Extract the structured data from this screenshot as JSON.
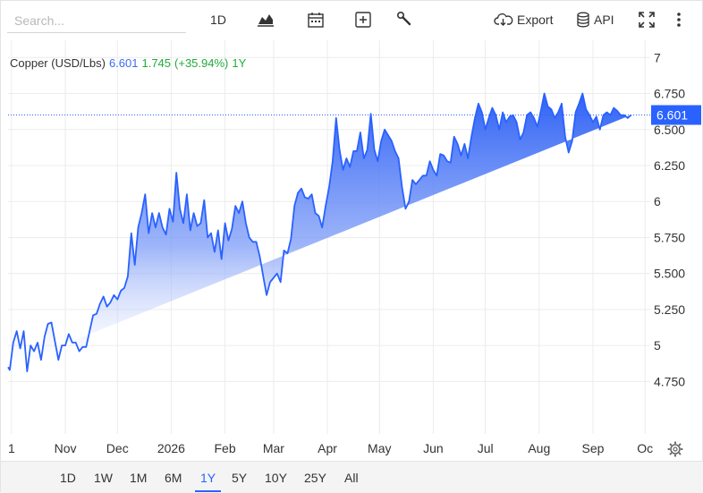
{
  "toolbar": {
    "search_placeholder": "Search...",
    "interval": "1D",
    "export_label": "Export",
    "api_label": "API"
  },
  "legend": {
    "instrument": "Copper (USD/Lbs)",
    "last": "6.601",
    "change": "1.745",
    "change_pct": "(+35.94%)",
    "period": "1Y"
  },
  "colors": {
    "line": "#2962ff",
    "positive": "#22ab3a",
    "value_blue": "#3b6cf0",
    "price_tag": "#2962ff"
  },
  "range_buttons": [
    "1D",
    "1W",
    "1M",
    "6M",
    "1Y",
    "5Y",
    "10Y",
    "25Y",
    "All"
  ],
  "active_range": "1Y",
  "chart_data": {
    "type": "area",
    "title": "Copper (USD/Lbs)",
    "last_value": 6.601,
    "last_value_label": "6.601",
    "ylim": [
      4.51,
      7.12
    ],
    "y_ticks": [
      4.75,
      5,
      5.25,
      5.5,
      5.75,
      6,
      6.25,
      6.5,
      6.75,
      7
    ],
    "y_tick_labels": [
      "4.750",
      "5",
      "5.250",
      "5.500",
      "5.750",
      "6",
      "6.250",
      "6.500",
      "6.750",
      "7"
    ],
    "xlim": [
      "2025-09-29",
      "2026-10-04"
    ],
    "x_ticks": [
      "2025-10-01",
      "2025-11-01",
      "2025-12-01",
      "2026-01-01",
      "2026-02-01",
      "2026-03-01",
      "2026-04-01",
      "2026-05-01",
      "2026-06-01",
      "2026-07-01",
      "2026-08-01",
      "2026-09-01",
      "2026-10-01"
    ],
    "x_tick_labels": [
      "1",
      "Nov",
      "Dec",
      "2026",
      "Feb",
      "Mar",
      "Apr",
      "May",
      "Jun",
      "Jul",
      "Aug",
      "Sep",
      "Oc"
    ],
    "grid": true,
    "x": [
      "2025-09-29",
      "2025-09-30",
      "2025-10-02",
      "2025-10-04",
      "2025-10-06",
      "2025-10-08",
      "2025-10-10",
      "2025-10-12",
      "2025-10-14",
      "2025-10-16",
      "2025-10-18",
      "2025-10-20",
      "2025-10-22",
      "2025-10-24",
      "2025-10-26",
      "2025-10-28",
      "2025-10-30",
      "2025-11-01",
      "2025-11-03",
      "2025-11-05",
      "2025-11-07",
      "2025-11-09",
      "2025-11-11",
      "2025-11-13",
      "2025-11-15",
      "2025-11-17",
      "2025-11-19",
      "2025-11-21",
      "2025-11-23",
      "2025-11-25",
      "2025-11-27",
      "2025-11-29",
      "2025-12-01",
      "2025-12-03",
      "2025-12-05",
      "2025-12-07",
      "2025-12-09",
      "2025-12-11",
      "2025-12-13",
      "2025-12-15",
      "2025-12-17",
      "2025-12-19",
      "2025-12-21",
      "2025-12-23",
      "2025-12-25",
      "2025-12-27",
      "2025-12-29",
      "2025-12-31",
      "2026-01-02",
      "2026-01-04",
      "2026-01-06",
      "2026-01-08",
      "2026-01-10",
      "2026-01-12",
      "2026-01-14",
      "2026-01-16",
      "2026-01-18",
      "2026-01-20",
      "2026-01-22",
      "2026-01-24",
      "2026-01-26",
      "2026-01-28",
      "2026-01-30",
      "2026-02-01",
      "2026-02-03",
      "2026-02-05",
      "2026-02-07",
      "2026-02-09",
      "2026-02-11",
      "2026-02-13",
      "2026-02-15",
      "2026-02-17",
      "2026-02-19",
      "2026-02-21",
      "2026-02-23",
      "2026-02-25",
      "2026-02-27",
      "2026-03-01",
      "2026-03-03",
      "2026-03-05",
      "2026-03-07",
      "2026-03-09",
      "2026-03-11",
      "2026-03-13",
      "2026-03-15",
      "2026-03-17",
      "2026-03-19",
      "2026-03-21",
      "2026-03-23",
      "2026-03-25",
      "2026-03-27",
      "2026-03-29",
      "2026-03-31",
      "2026-04-02",
      "2026-04-04",
      "2026-04-06",
      "2026-04-08",
      "2026-04-10",
      "2026-04-12",
      "2026-04-14",
      "2026-04-16",
      "2026-04-18",
      "2026-04-20",
      "2026-04-22",
      "2026-04-24",
      "2026-04-26",
      "2026-04-28",
      "2026-04-30",
      "2026-05-02",
      "2026-05-04",
      "2026-05-06",
      "2026-05-08",
      "2026-05-10",
      "2026-05-12",
      "2026-05-14",
      "2026-05-16",
      "2026-05-18",
      "2026-05-20",
      "2026-05-22",
      "2026-05-24",
      "2026-05-26",
      "2026-05-28",
      "2026-05-30",
      "2026-06-01",
      "2026-06-03",
      "2026-06-05",
      "2026-06-07",
      "2026-06-09",
      "2026-06-11",
      "2026-06-13",
      "2026-06-15",
      "2026-06-17",
      "2026-06-19",
      "2026-06-21",
      "2026-06-23",
      "2026-06-25",
      "2026-06-27",
      "2026-06-29",
      "2026-07-01",
      "2026-07-03",
      "2026-07-05",
      "2026-07-07",
      "2026-07-09",
      "2026-07-11",
      "2026-07-13",
      "2026-07-15",
      "2026-07-17",
      "2026-07-19",
      "2026-07-21",
      "2026-07-23",
      "2026-07-25",
      "2026-07-27",
      "2026-07-29",
      "2026-07-31",
      "2026-08-02",
      "2026-08-04",
      "2026-08-06",
      "2026-08-08",
      "2026-08-10",
      "2026-08-12",
      "2026-08-14",
      "2026-08-16",
      "2026-08-18",
      "2026-08-20",
      "2026-08-22",
      "2026-08-24",
      "2026-08-26",
      "2026-08-28",
      "2026-08-30",
      "2026-09-01",
      "2026-09-03",
      "2026-09-05",
      "2026-09-07",
      "2026-09-09",
      "2026-09-11",
      "2026-09-13",
      "2026-09-15",
      "2026-09-17",
      "2026-09-19",
      "2026-09-21",
      "2026-09-23",
      "2026-09-25",
      "2026-09-27",
      "2026-09-29"
    ],
    "values": [
      4.85,
      4.83,
      5.02,
      5.1,
      4.98,
      5.1,
      4.82,
      5.0,
      4.96,
      5.02,
      4.9,
      5.06,
      5.15,
      5.16,
      5.03,
      4.9,
      5.0,
      5.0,
      5.08,
      5.02,
      5.02,
      4.96,
      4.99,
      4.99,
      5.1,
      5.21,
      5.22,
      5.29,
      5.34,
      5.27,
      5.3,
      5.35,
      5.32,
      5.38,
      5.4,
      5.48,
      5.78,
      5.56,
      5.82,
      5.92,
      6.05,
      5.78,
      5.92,
      5.82,
      5.92,
      5.82,
      5.77,
      5.95,
      5.86,
      6.2,
      5.95,
      5.85,
      6.05,
      5.8,
      5.92,
      5.83,
      5.85,
      6.01,
      5.75,
      5.78,
      5.65,
      5.8,
      5.6,
      5.85,
      5.73,
      5.81,
      5.97,
      5.92,
      6.0,
      5.85,
      5.75,
      5.72,
      5.72,
      5.62,
      5.48,
      5.35,
      5.44,
      5.47,
      5.5,
      5.44,
      5.66,
      5.64,
      5.74,
      5.97,
      6.06,
      6.09,
      6.03,
      6.02,
      6.05,
      5.92,
      5.9,
      5.82,
      5.97,
      6.1,
      6.28,
      6.58,
      6.36,
      6.22,
      6.3,
      6.24,
      6.35,
      6.35,
      6.48,
      6.3,
      6.36,
      6.61,
      6.36,
      6.28,
      6.42,
      6.5,
      6.46,
      6.42,
      6.35,
      6.3,
      6.1,
      5.95,
      6.0,
      6.15,
      6.12,
      6.15,
      6.18,
      6.18,
      6.28,
      6.22,
      6.18,
      6.33,
      6.32,
      6.28,
      6.27,
      6.45,
      6.4,
      6.32,
      6.4,
      6.3,
      6.45,
      6.58,
      6.68,
      6.62,
      6.5,
      6.58,
      6.65,
      6.6,
      6.5,
      6.62,
      6.55,
      6.59,
      6.6,
      6.55,
      6.43,
      6.48,
      6.6,
      6.62,
      6.58,
      6.52,
      6.63,
      6.75,
      6.66,
      6.64,
      6.58,
      6.62,
      6.68,
      6.45,
      6.34,
      6.42,
      6.62,
      6.68,
      6.75,
      6.64,
      6.6,
      6.55,
      6.59,
      6.5,
      6.6,
      6.62,
      6.6,
      6.65,
      6.63,
      6.6,
      6.6,
      6.58,
      6.601
    ]
  }
}
